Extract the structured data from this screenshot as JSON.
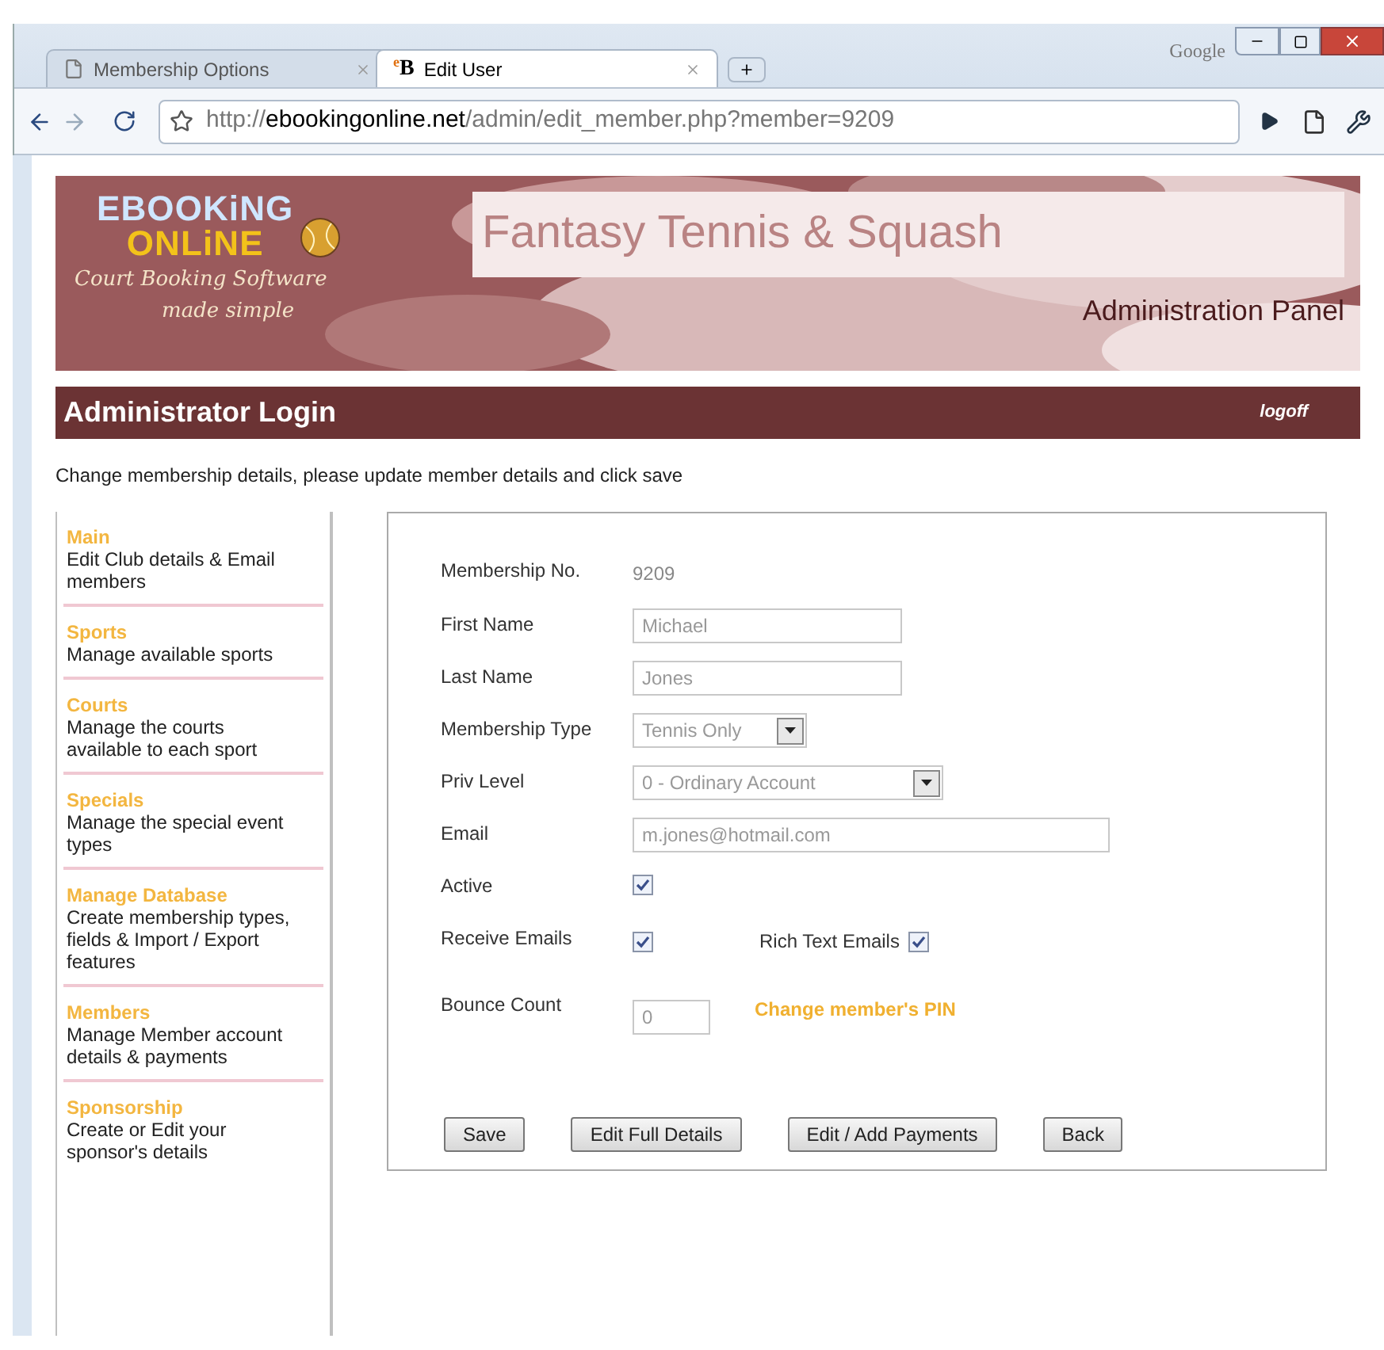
{
  "browser": {
    "brand": "Google",
    "tabs": [
      {
        "label": "Membership Options",
        "selected": false
      },
      {
        "label": "Edit User",
        "selected": true,
        "favicon": "$^{e}$B"
      }
    ],
    "address": {
      "scheme": "http://",
      "host": "ebookingonline.net",
      "path": "/admin/edit_member.php?member=9209"
    }
  },
  "banner": {
    "logo_top": "EBOOKiNG",
    "logo_bottom": "ONLiNE",
    "tagline_1": "Court Booking Software",
    "tagline_2": "made simple",
    "club_name": "Fantasy Tennis & Squash",
    "panel_title": "Administration Panel"
  },
  "header": {
    "title": "Administrator Login",
    "link": "logoff"
  },
  "intro": "Change membership details, please update member details and click save",
  "sidebar": {
    "items": [
      {
        "title": "Main",
        "description": "Edit Club details & Email members"
      },
      {
        "title": "Sports",
        "description": "Manage available sports"
      },
      {
        "title": "Courts",
        "description": "Manage the courts available to each sport"
      },
      {
        "title": "Specials",
        "description": "Manage the special event types"
      },
      {
        "title": "Manage Database",
        "description": "Create membership types, fields & Import / Export features"
      },
      {
        "title": "Members",
        "description": "Manage Member account details & payments"
      },
      {
        "title": "Sponsorship",
        "description": "Create or Edit your sponsor's details"
      }
    ]
  },
  "form": {
    "rows": [
      {
        "label": "Membership No.",
        "kind": "static",
        "value": "9209"
      },
      {
        "label": "First Name",
        "kind": "input",
        "value": "Michael"
      },
      {
        "label": "Last Name",
        "kind": "input",
        "value": "Jones"
      },
      {
        "label": "Membership Type",
        "kind": "select",
        "value": "Tennis Only"
      },
      {
        "label": "Priv Level",
        "kind": "wide_select",
        "value": "0 - Ordinary Account"
      },
      {
        "label": "Email",
        "kind": "wide_input",
        "value": "m.jones@hotmail.com"
      },
      {
        "label": "Active",
        "kind": "checkbox",
        "checked": true
      },
      {
        "label": "Receive Emails",
        "kind": "checkbox",
        "checked": true,
        "extra": {
          "label": "Rich Text Emails",
          "checked": true
        }
      },
      {
        "label": "Bounce Count",
        "kind": "small_input",
        "value": "0",
        "link": "Change member's PIN"
      }
    ],
    "buttons": [
      "Save",
      "Edit Full Details",
      "Edit / Add Payments",
      "Back"
    ]
  }
}
